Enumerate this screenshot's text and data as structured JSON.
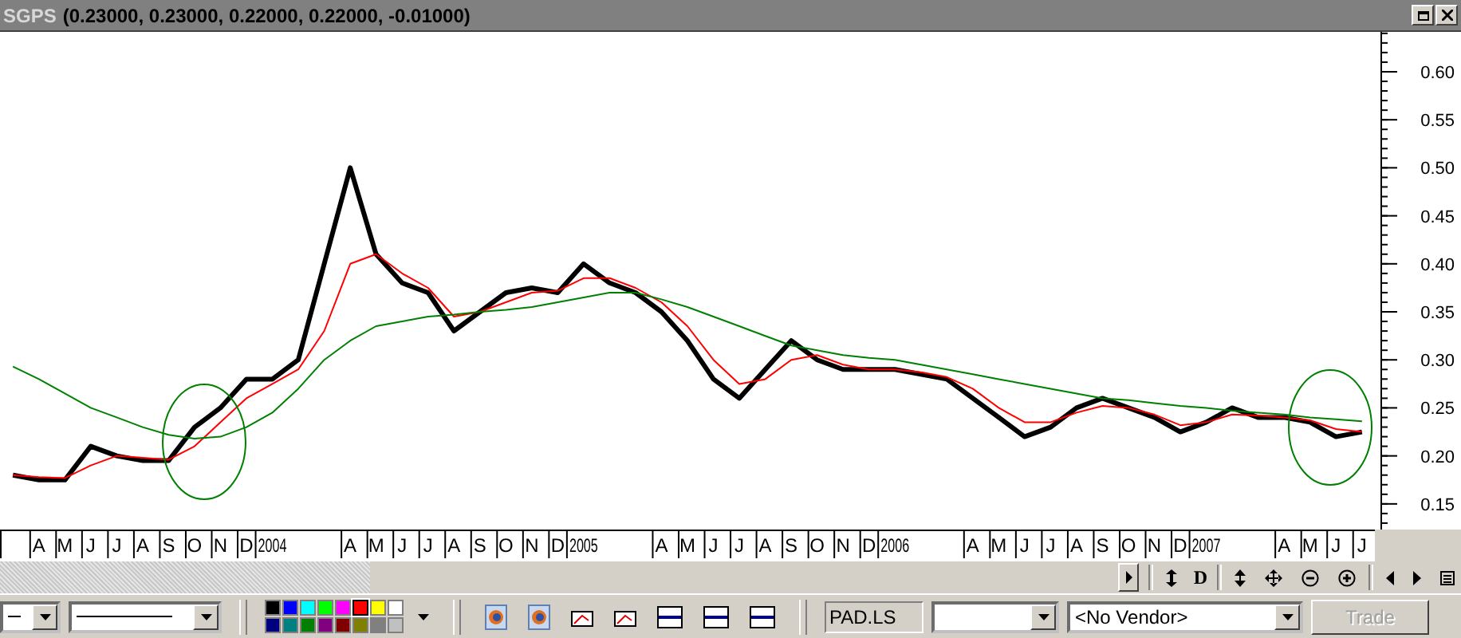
{
  "window": {
    "title": "SGPS",
    "quote": "(0.23000, 0.23000, 0.22000, 0.22000, -0.01000)"
  },
  "chart": {
    "chart_data": {
      "type": "line",
      "ylim": [
        0.1233,
        0.6415
      ],
      "yticks": [
        {
          "value": 0.15,
          "label": "0.15"
        },
        {
          "value": 0.2,
          "label": "0.20"
        },
        {
          "value": 0.25,
          "label": "0.25"
        },
        {
          "value": 0.3,
          "label": "0.30"
        },
        {
          "value": 0.35,
          "label": "0.35"
        },
        {
          "value": 0.4,
          "label": "0.40"
        },
        {
          "value": 0.45,
          "label": "0.45"
        },
        {
          "value": 0.5,
          "label": "0.50"
        },
        {
          "value": 0.55,
          "label": "0.55"
        },
        {
          "value": 0.6,
          "label": "0.60"
        }
      ],
      "categories": [
        null,
        "A",
        "M",
        "J",
        "J",
        "A",
        "S",
        "O",
        "N",
        "D",
        "2004",
        null,
        null,
        "A",
        "M",
        "J",
        "J",
        "A",
        "S",
        "O",
        "N",
        "D",
        "2005",
        null,
        null,
        "A",
        "M",
        "J",
        "J",
        "A",
        "S",
        "O",
        "N",
        "D",
        "2006",
        null,
        null,
        "A",
        "M",
        "J",
        "J",
        "A",
        "S",
        "O",
        "N",
        "D",
        "2007",
        null,
        null,
        "A",
        "M",
        "J",
        "J"
      ],
      "series": [
        {
          "color": "#000000",
          "values": [
            0.18,
            0.175,
            0.175,
            0.21,
            0.2,
            0.195,
            0.195,
            0.23,
            0.25,
            0.28,
            0.28,
            0.3,
            0.4,
            0.5,
            0.41,
            0.38,
            0.37,
            0.33,
            0.35,
            0.37,
            0.375,
            0.37,
            0.4,
            0.38,
            0.37,
            0.35,
            0.32,
            0.28,
            0.26,
            0.29,
            0.32,
            0.3,
            0.29,
            0.29,
            0.29,
            0.285,
            0.28,
            0.26,
            0.24,
            0.22,
            0.23,
            0.25,
            0.26,
            0.25,
            0.24,
            0.225,
            0.235,
            0.25,
            0.24,
            0.24,
            0.235,
            0.22,
            0.225
          ]
        },
        {
          "color": "#ff0000",
          "values": [
            0.18,
            0.178,
            0.177,
            0.19,
            0.2,
            0.198,
            0.196,
            0.21,
            0.235,
            0.26,
            0.275,
            0.29,
            0.33,
            0.4,
            0.41,
            0.39,
            0.375,
            0.345,
            0.35,
            0.36,
            0.37,
            0.372,
            0.385,
            0.385,
            0.375,
            0.36,
            0.335,
            0.3,
            0.275,
            0.28,
            0.3,
            0.305,
            0.295,
            0.29,
            0.29,
            0.287,
            0.282,
            0.27,
            0.25,
            0.235,
            0.235,
            0.245,
            0.252,
            0.25,
            0.243,
            0.232,
            0.235,
            0.243,
            0.242,
            0.24,
            0.237,
            0.228,
            0.225
          ]
        },
        {
          "color": "#008000",
          "values": [
            0.293,
            0.28,
            0.265,
            0.25,
            0.24,
            0.23,
            0.222,
            0.218,
            0.22,
            0.23,
            0.245,
            0.27,
            0.3,
            0.32,
            0.335,
            0.34,
            0.345,
            0.347,
            0.35,
            0.352,
            0.355,
            0.36,
            0.365,
            0.37,
            0.37,
            0.363,
            0.355,
            0.345,
            0.335,
            0.325,
            0.315,
            0.31,
            0.305,
            0.302,
            0.3,
            0.295,
            0.29,
            0.285,
            0.28,
            0.275,
            0.27,
            0.265,
            0.26,
            0.258,
            0.255,
            0.252,
            0.25,
            0.247,
            0.245,
            0.243,
            0.24,
            0.238,
            0.236
          ]
        }
      ]
    }
  },
  "nav": {
    "d_button": "D"
  },
  "toolbar": {
    "palette": [
      {
        "color": "#000000",
        "selected": false
      },
      {
        "color": "#0000ff",
        "selected": false
      },
      {
        "color": "#00ffff",
        "selected": false
      },
      {
        "color": "#00ff00",
        "selected": false
      },
      {
        "color": "#ff00ff",
        "selected": false
      },
      {
        "color": "#ff0000",
        "selected": true
      },
      {
        "color": "#ffff00",
        "selected": false
      },
      {
        "color": "#ffffff",
        "selected": false
      },
      {
        "color": "#000080",
        "selected": false
      },
      {
        "color": "#008080",
        "selected": false
      },
      {
        "color": "#008000",
        "selected": false
      },
      {
        "color": "#800080",
        "selected": false
      },
      {
        "color": "#800000",
        "selected": false
      },
      {
        "color": "#808000",
        "selected": false
      },
      {
        "color": "#808080",
        "selected": false
      },
      {
        "color": "#c0c0c0",
        "selected": false
      }
    ],
    "symbol": "PAD.LS",
    "vendor": "<No Vendor>",
    "trade": {
      "label": "Trade",
      "disabled": true
    }
  }
}
